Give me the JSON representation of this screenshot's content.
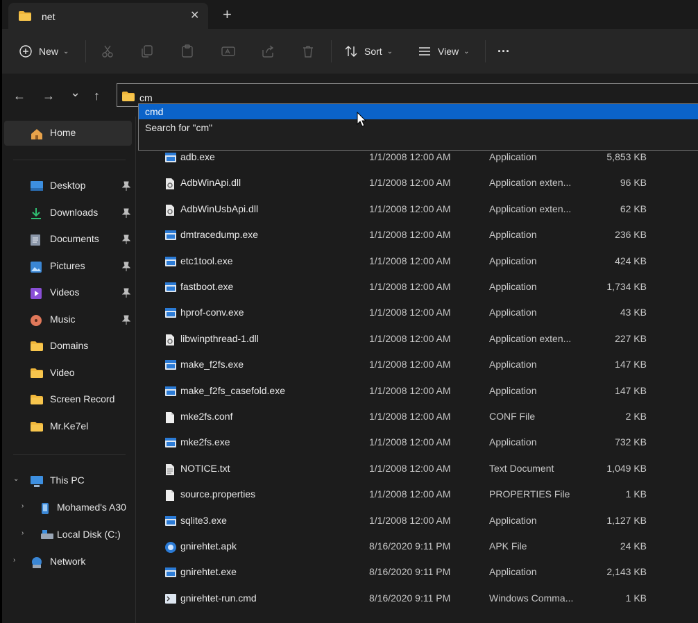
{
  "window": {
    "tab_title": "net",
    "close_glyph": "✕",
    "newtab_glyph": "+"
  },
  "toolbar": {
    "new_label": "New",
    "sort_label": "Sort",
    "view_label": "View",
    "more_label": "···",
    "icons": [
      "cut-icon",
      "copy-icon",
      "paste-icon",
      "rename-icon",
      "share-icon",
      "delete-icon"
    ]
  },
  "address": {
    "value": "cm",
    "suggestions": [
      "cmd",
      "Search for \"cm\""
    ]
  },
  "nav": {
    "back": "←",
    "forward": "→",
    "recent": "⌄",
    "up": "↑"
  },
  "sidebar": {
    "home": "Home",
    "quick_access": [
      {
        "label": "Desktop",
        "icon": "desktop-icon",
        "color": "#3d8fe0",
        "pinned": true
      },
      {
        "label": "Downloads",
        "icon": "downloads-icon",
        "color": "#2fbf71",
        "pinned": true
      },
      {
        "label": "Documents",
        "icon": "documents-icon",
        "color": "#8a96a8",
        "pinned": true
      },
      {
        "label": "Pictures",
        "icon": "pictures-icon",
        "color": "#3a86d4",
        "pinned": true
      },
      {
        "label": "Videos",
        "icon": "videos-icon",
        "color": "#8a4fd6",
        "pinned": true
      },
      {
        "label": "Music",
        "icon": "music-icon",
        "color": "#e0785a",
        "pinned": true
      },
      {
        "label": "Domains",
        "icon": "folder-icon",
        "color": "#f0b63a",
        "pinned": false
      },
      {
        "label": "Video",
        "icon": "folder-icon",
        "color": "#f0b63a",
        "pinned": false
      },
      {
        "label": "Screen Record",
        "icon": "folder-icon",
        "color": "#f0b63a",
        "pinned": false
      },
      {
        "label": "Mr.Ke7el",
        "icon": "folder-icon",
        "color": "#f0b63a",
        "pinned": false
      }
    ],
    "this_pc": "This PC",
    "pc_children": [
      "Mohamed's A30",
      "Local Disk (C:)"
    ],
    "network": "Network"
  },
  "files": [
    {
      "name": "adb.exe",
      "date": "1/1/2008 12:00 AM",
      "type": "Application",
      "size": "5,853 KB",
      "icon": "exe"
    },
    {
      "name": "AdbWinApi.dll",
      "date": "1/1/2008 12:00 AM",
      "type": "Application exten...",
      "size": "96 KB",
      "icon": "dll"
    },
    {
      "name": "AdbWinUsbApi.dll",
      "date": "1/1/2008 12:00 AM",
      "type": "Application exten...",
      "size": "62 KB",
      "icon": "dll"
    },
    {
      "name": "dmtracedump.exe",
      "date": "1/1/2008 12:00 AM",
      "type": "Application",
      "size": "236 KB",
      "icon": "exe"
    },
    {
      "name": "etc1tool.exe",
      "date": "1/1/2008 12:00 AM",
      "type": "Application",
      "size": "424 KB",
      "icon": "exe"
    },
    {
      "name": "fastboot.exe",
      "date": "1/1/2008 12:00 AM",
      "type": "Application",
      "size": "1,734 KB",
      "icon": "exe"
    },
    {
      "name": "hprof-conv.exe",
      "date": "1/1/2008 12:00 AM",
      "type": "Application",
      "size": "43 KB",
      "icon": "exe"
    },
    {
      "name": "libwinpthread-1.dll",
      "date": "1/1/2008 12:00 AM",
      "type": "Application exten...",
      "size": "227 KB",
      "icon": "dll"
    },
    {
      "name": "make_f2fs.exe",
      "date": "1/1/2008 12:00 AM",
      "type": "Application",
      "size": "147 KB",
      "icon": "exe"
    },
    {
      "name": "make_f2fs_casefold.exe",
      "date": "1/1/2008 12:00 AM",
      "type": "Application",
      "size": "147 KB",
      "icon": "exe"
    },
    {
      "name": "mke2fs.conf",
      "date": "1/1/2008 12:00 AM",
      "type": "CONF File",
      "size": "2 KB",
      "icon": "file"
    },
    {
      "name": "mke2fs.exe",
      "date": "1/1/2008 12:00 AM",
      "type": "Application",
      "size": "732 KB",
      "icon": "exe"
    },
    {
      "name": "NOTICE.txt",
      "date": "1/1/2008 12:00 AM",
      "type": "Text Document",
      "size": "1,049 KB",
      "icon": "txt"
    },
    {
      "name": "source.properties",
      "date": "1/1/2008 12:00 AM",
      "type": "PROPERTIES File",
      "size": "1 KB",
      "icon": "file"
    },
    {
      "name": "sqlite3.exe",
      "date": "1/1/2008 12:00 AM",
      "type": "Application",
      "size": "1,127 KB",
      "icon": "exe"
    },
    {
      "name": "gnirehtet.apk",
      "date": "8/16/2020 9:11 PM",
      "type": "APK File",
      "size": "24 KB",
      "icon": "apk"
    },
    {
      "name": "gnirehtet.exe",
      "date": "8/16/2020 9:11 PM",
      "type": "Application",
      "size": "2,143 KB",
      "icon": "exe"
    },
    {
      "name": "gnirehtet-run.cmd",
      "date": "8/16/2020 9:11 PM",
      "type": "Windows Comma...",
      "size": "1 KB",
      "icon": "cmd"
    }
  ],
  "colors": {
    "accent_selection": "#0b63c9",
    "folder": "#f0b63a",
    "app_icon": "#2b7bd6"
  }
}
